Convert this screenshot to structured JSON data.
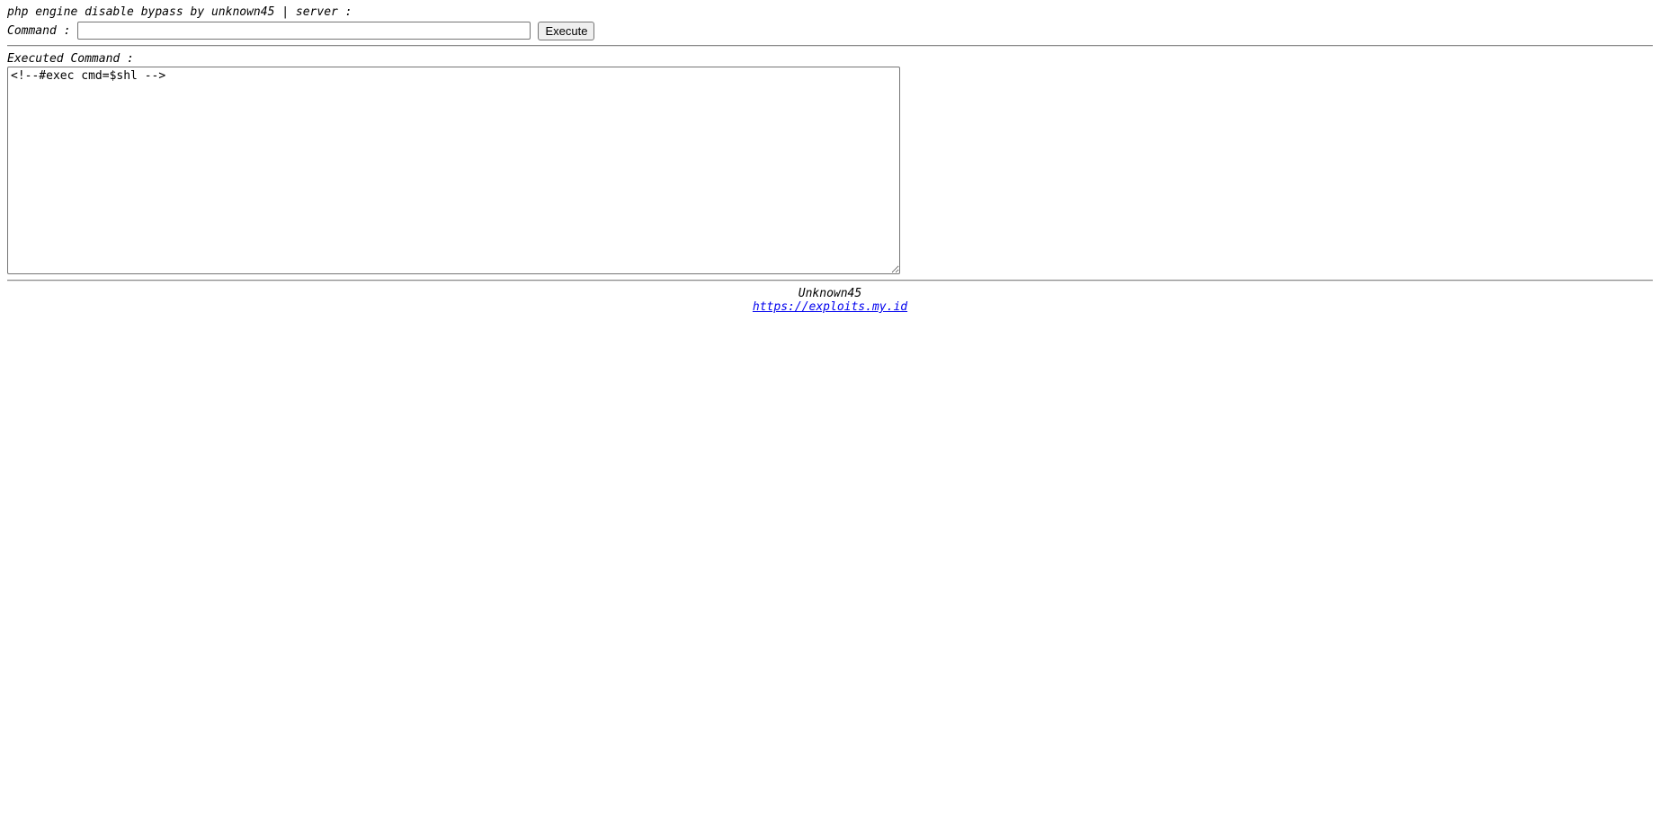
{
  "header": {
    "title_line": "php engine disable bypass by unknown45 | server :"
  },
  "command": {
    "label": "Command :",
    "value": "",
    "placeholder": "",
    "execute_label": "Execute"
  },
  "output": {
    "label": "Executed Command :",
    "content": "<!--#exec cmd=$shl -->"
  },
  "footer": {
    "author": "Unknown45",
    "link_text": "https://exploits.my.id",
    "link_href": "https://exploits.my.id"
  },
  "colors": {
    "link": "#0000ee",
    "text": "#000000",
    "background": "#ffffff"
  }
}
